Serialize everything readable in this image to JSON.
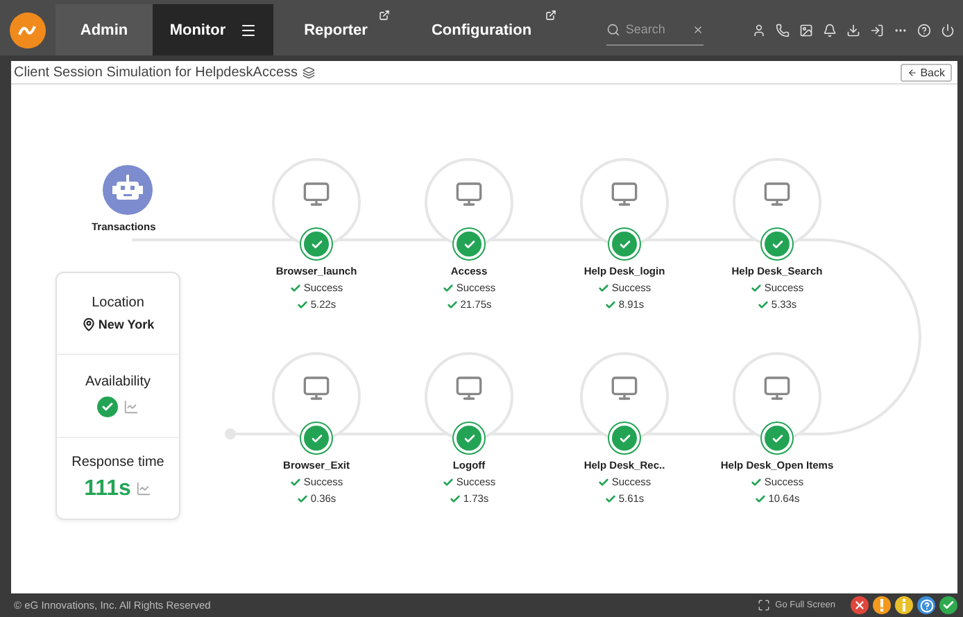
{
  "nav": {
    "tabs": [
      {
        "label": "Admin",
        "selected": false,
        "external": false,
        "menu": false
      },
      {
        "label": "Monitor",
        "selected": true,
        "external": false,
        "menu": true
      },
      {
        "label": "Reporter",
        "selected": false,
        "external": true,
        "menu": false
      },
      {
        "label": "Configuration",
        "selected": false,
        "external": true,
        "menu": false
      }
    ],
    "search": {
      "placeholder": "Search"
    }
  },
  "header": {
    "title": "Client Session Simulation for HelpdeskAccess",
    "back": "Back"
  },
  "diagram": {
    "start": {
      "label": "Transactions"
    },
    "steps": [
      {
        "name": "Browser_launch",
        "status": "Success",
        "time": "5.22s",
        "ok": true
      },
      {
        "name": "Access",
        "status": "Success",
        "time": "21.75s",
        "ok": true
      },
      {
        "name": "Help Desk_login",
        "status": "Success",
        "time": "8.91s",
        "ok": true
      },
      {
        "name": "Help Desk_Search",
        "status": "Success",
        "time": "5.33s",
        "ok": true
      },
      {
        "name": "Browser_Exit",
        "status": "Success",
        "time": "0.36s",
        "ok": true
      },
      {
        "name": "Logoff",
        "status": "Success",
        "time": "1.73s",
        "ok": true
      },
      {
        "name": "Help Desk_Rec..",
        "status": "Success",
        "time": "5.61s",
        "ok": true
      },
      {
        "name": "Help Desk_Open Items",
        "status": "Success",
        "time": "10.64s",
        "ok": true
      }
    ]
  },
  "summary": {
    "location_label": "Location",
    "location": "New York",
    "availability_label": "Availability",
    "availability_ok": true,
    "response_label": "Response time",
    "response": "111s"
  },
  "footer": {
    "copyright": "© eG Innovations, Inc. All Rights Reserved",
    "fullscreen": "Go Full Screen",
    "alerts": [
      {
        "kind": "error",
        "color": "#e0463c"
      },
      {
        "kind": "warning",
        "color": "#f39a1e"
      },
      {
        "kind": "info",
        "color": "#e9c02a"
      },
      {
        "kind": "help",
        "color": "#3b8fd9"
      },
      {
        "kind": "ok",
        "color": "#2faa4f"
      }
    ]
  }
}
